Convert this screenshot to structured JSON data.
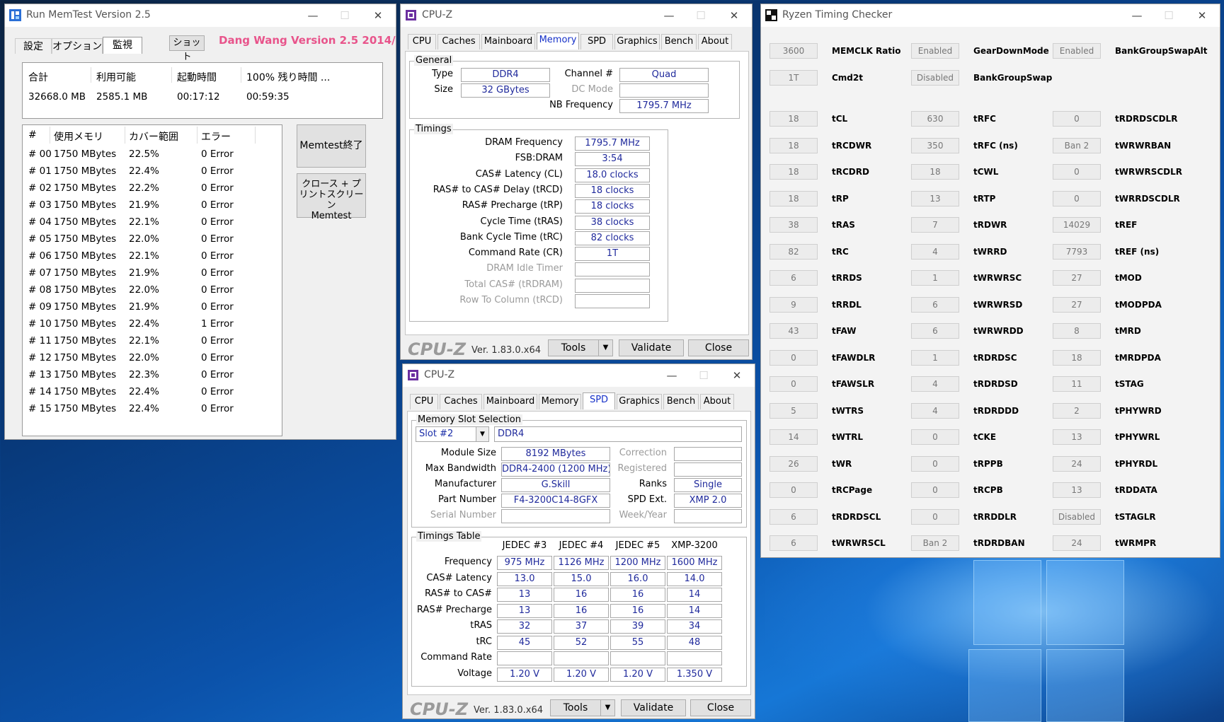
{
  "memtest": {
    "title": "Run MemTest Version 2.5",
    "menu": [
      "設定",
      "オプション",
      "監視"
    ],
    "shot_button": "ショット",
    "version_text": "Dang Wang Version 2.5 2014/09/22",
    "summary_headers": [
      "合計",
      "利用可能",
      "起動時間",
      "100% 残り時間 ..."
    ],
    "summary_values": [
      "32668.0 MB",
      "2585.1 MB",
      "00:17:12",
      "00:59:35"
    ],
    "table_headers": [
      "#",
      "使用メモリ",
      "カバー範囲",
      "エラー"
    ],
    "rows": [
      [
        "# 00",
        "1750 MBytes",
        "22.5%",
        "0 Error"
      ],
      [
        "# 01",
        "1750 MBytes",
        "22.4%",
        "0 Error"
      ],
      [
        "# 02",
        "1750 MBytes",
        "22.2%",
        "0 Error"
      ],
      [
        "# 03",
        "1750 MBytes",
        "21.9%",
        "0 Error"
      ],
      [
        "# 04",
        "1750 MBytes",
        "22.1%",
        "0 Error"
      ],
      [
        "# 05",
        "1750 MBytes",
        "22.0%",
        "0 Error"
      ],
      [
        "# 06",
        "1750 MBytes",
        "22.1%",
        "0 Error"
      ],
      [
        "# 07",
        "1750 MBytes",
        "21.9%",
        "0 Error"
      ],
      [
        "# 08",
        "1750 MBytes",
        "22.0%",
        "0 Error"
      ],
      [
        "# 09",
        "1750 MBytes",
        "21.9%",
        "0 Error"
      ],
      [
        "# 10",
        "1750 MBytes",
        "22.4%",
        "1 Error"
      ],
      [
        "# 11",
        "1750 MBytes",
        "22.1%",
        "0 Error"
      ],
      [
        "# 12",
        "1750 MBytes",
        "22.0%",
        "0 Error"
      ],
      [
        "# 13",
        "1750 MBytes",
        "22.3%",
        "0 Error"
      ],
      [
        "# 14",
        "1750 MBytes",
        "22.4%",
        "0 Error"
      ],
      [
        "# 15",
        "1750 MBytes",
        "22.4%",
        "0 Error"
      ]
    ],
    "btn_end": "Memtest終了",
    "btn_close_line1": "クロース + プ",
    "btn_close_line2": "リントスクリーン",
    "btn_close_line3": "Memtest"
  },
  "window_controls": {
    "minimize": "—",
    "maximize": "☐",
    "close": "✕"
  },
  "cpuz_mem": {
    "title": "CPU-Z",
    "tabs": [
      "CPU",
      "Caches",
      "Mainboard",
      "Memory",
      "SPD",
      "Graphics",
      "Bench",
      "About"
    ],
    "active_tab": "Memory",
    "general_label": "General",
    "type_label": "Type",
    "type_value": "DDR4",
    "size_label": "Size",
    "size_value": "32 GBytes",
    "channel_label": "Channel #",
    "channel_value": "Quad",
    "dcmode_label": "DC Mode",
    "dcmode_value": "",
    "nbfreq_label": "NB Frequency",
    "nbfreq_value": "1795.7 MHz",
    "timings_label": "Timings",
    "timings": [
      {
        "label": "DRAM Frequency",
        "value": "1795.7 MHz",
        "dim": false
      },
      {
        "label": "FSB:DRAM",
        "value": "3:54",
        "dim": false
      },
      {
        "label": "CAS# Latency (CL)",
        "value": "18.0 clocks",
        "dim": false
      },
      {
        "label": "RAS# to CAS# Delay (tRCD)",
        "value": "18 clocks",
        "dim": false
      },
      {
        "label": "RAS# Precharge (tRP)",
        "value": "18 clocks",
        "dim": false
      },
      {
        "label": "Cycle Time (tRAS)",
        "value": "38 clocks",
        "dim": false
      },
      {
        "label": "Bank Cycle Time (tRC)",
        "value": "82 clocks",
        "dim": false
      },
      {
        "label": "Command Rate (CR)",
        "value": "1T",
        "dim": false
      },
      {
        "label": "DRAM Idle Timer",
        "value": "",
        "dim": true
      },
      {
        "label": "Total CAS# (tRDRAM)",
        "value": "",
        "dim": true
      },
      {
        "label": "Row To Column (tRCD)",
        "value": "",
        "dim": true
      }
    ],
    "brand": "CPU-Z",
    "version": "Ver. 1.83.0.x64",
    "tools": "Tools",
    "validate": "Validate",
    "close": "Close"
  },
  "cpuz_spd": {
    "title": "CPU-Z",
    "tabs": [
      "CPU",
      "Caches",
      "Mainboard",
      "Memory",
      "SPD",
      "Graphics",
      "Bench",
      "About"
    ],
    "active_tab": "SPD",
    "slot_group": "Memory Slot Selection",
    "slot_value": "Slot #2",
    "slot_type": "DDR4",
    "module_size_label": "Module Size",
    "module_size": "8192 MBytes",
    "max_bw_label": "Max Bandwidth",
    "max_bw": "DDR4-2400 (1200 MHz)",
    "manufacturer_label": "Manufacturer",
    "manufacturer": "G.Skill",
    "part_label": "Part Number",
    "part": "F4-3200C14-8GFX",
    "serial_label": "Serial Number",
    "serial": "",
    "correction_label": "Correction",
    "correction": "",
    "registered_label": "Registered",
    "registered": "",
    "ranks_label": "Ranks",
    "ranks": "Single",
    "spdext_label": "SPD Ext.",
    "spdext": "XMP 2.0",
    "week_label": "Week/Year",
    "week": "",
    "timings_table_label": "Timings Table",
    "cols": [
      "JEDEC #3",
      "JEDEC #4",
      "JEDEC #5",
      "XMP-3200"
    ],
    "rows": [
      {
        "label": "Frequency",
        "values": [
          "975 MHz",
          "1126 MHz",
          "1200 MHz",
          "1600 MHz"
        ]
      },
      {
        "label": "CAS# Latency",
        "values": [
          "13.0",
          "15.0",
          "16.0",
          "14.0"
        ]
      },
      {
        "label": "RAS# to CAS#",
        "values": [
          "13",
          "16",
          "16",
          "14"
        ]
      },
      {
        "label": "RAS# Precharge",
        "values": [
          "13",
          "16",
          "16",
          "14"
        ]
      },
      {
        "label": "tRAS",
        "values": [
          "32",
          "37",
          "39",
          "34"
        ]
      },
      {
        "label": "tRC",
        "values": [
          "45",
          "52",
          "55",
          "48"
        ]
      },
      {
        "label": "Command Rate",
        "values": [
          "",
          "",
          "",
          ""
        ]
      },
      {
        "label": "Voltage",
        "values": [
          "1.20 V",
          "1.20 V",
          "1.20 V",
          "1.350 V"
        ]
      }
    ],
    "brand": "CPU-Z",
    "version": "Ver. 1.83.0.x64",
    "tools": "Tools",
    "validate": "Validate",
    "close": "Close"
  },
  "ryzen": {
    "title": "Ryzen Timing Checker",
    "top": [
      {
        "value": "3600",
        "label": "MEMCLK Ratio"
      },
      {
        "value": "Enabled",
        "label": "GearDownMode"
      },
      {
        "value": "Enabled",
        "label": "BankGroupSwapAlt"
      },
      {
        "value": "1T",
        "label": "Cmd2t"
      },
      {
        "value": "Disabled",
        "label": "BankGroupSwap"
      }
    ],
    "col1": [
      [
        "18",
        "tCL"
      ],
      [
        "18",
        "tRCDWR"
      ],
      [
        "18",
        "tRCDRD"
      ],
      [
        "18",
        "tRP"
      ],
      [
        "38",
        "tRAS"
      ],
      [
        "82",
        "tRC"
      ],
      [
        "6",
        "tRRDS"
      ],
      [
        "9",
        "tRRDL"
      ],
      [
        "43",
        "tFAW"
      ],
      [
        "0",
        "tFAWDLR"
      ],
      [
        "0",
        "tFAWSLR"
      ],
      [
        "5",
        "tWTRS"
      ],
      [
        "14",
        "tWTRL"
      ],
      [
        "26",
        "tWR"
      ],
      [
        "0",
        "tRCPage"
      ],
      [
        "6",
        "tRDRDSCL"
      ],
      [
        "6",
        "tWRWRSCL"
      ]
    ],
    "col2": [
      [
        "630",
        "tRFC"
      ],
      [
        "350",
        "tRFC (ns)"
      ],
      [
        "18",
        "tCWL"
      ],
      [
        "13",
        "tRTP"
      ],
      [
        "7",
        "tRDWR"
      ],
      [
        "4",
        "tWRRD"
      ],
      [
        "1",
        "tWRWRSC"
      ],
      [
        "6",
        "tWRWRSD"
      ],
      [
        "6",
        "tWRWRDD"
      ],
      [
        "1",
        "tRDRDSC"
      ],
      [
        "4",
        "tRDRDSD"
      ],
      [
        "4",
        "tRDRDDD"
      ],
      [
        "0",
        "tCKE"
      ],
      [
        "0",
        "tRPPB"
      ],
      [
        "0",
        "tRCPB"
      ],
      [
        "0",
        "tRRDDLR"
      ],
      [
        "Ban 2",
        "tRDRDBAN"
      ]
    ],
    "col3": [
      [
        "0",
        "tRDRDSCDLR"
      ],
      [
        "Ban 2",
        "tWRWRBAN"
      ],
      [
        "0",
        "tWRWRSCDLR"
      ],
      [
        "0",
        "tWRRDSCDLR"
      ],
      [
        "14029",
        "tREF"
      ],
      [
        "7793",
        "tREF (ns)"
      ],
      [
        "27",
        "tMOD"
      ],
      [
        "27",
        "tMODPDA"
      ],
      [
        "8",
        "tMRD"
      ],
      [
        "18",
        "tMRDPDA"
      ],
      [
        "11",
        "tSTAG"
      ],
      [
        "2",
        "tPHYWRD"
      ],
      [
        "13",
        "tPHYWRL"
      ],
      [
        "24",
        "tPHYRDL"
      ],
      [
        "13",
        "tRDDATA"
      ],
      [
        "Disabled",
        "tSTAGLR"
      ],
      [
        "24",
        "tWRMPR"
      ]
    ]
  }
}
